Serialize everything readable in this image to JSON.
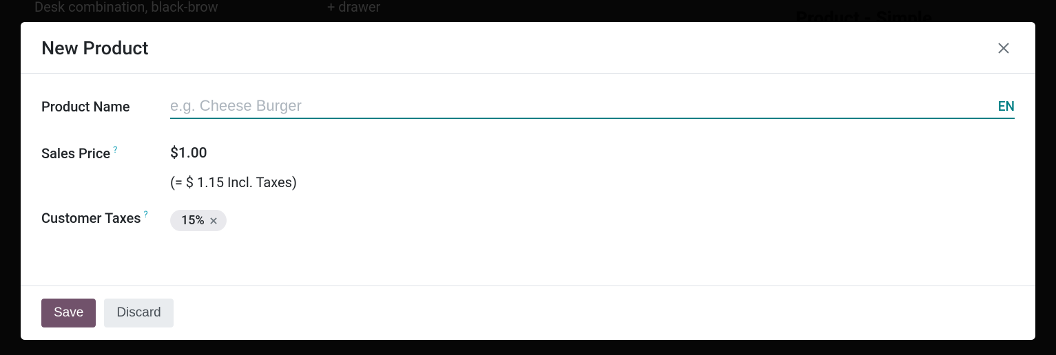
{
  "background": {
    "text_left": "Desk combination, black-brow",
    "text_mid": "+ drawer",
    "text_right": "Product - Simple"
  },
  "modal": {
    "title": "New Product",
    "fields": {
      "product_name": {
        "label": "Product Name",
        "placeholder": "e.g. Cheese Burger",
        "value": "",
        "lang": "EN"
      },
      "sales_price": {
        "label": "Sales Price",
        "value": "$1.00",
        "incl_taxes": "(= $ 1.15 Incl. Taxes)"
      },
      "customer_taxes": {
        "label": "Customer Taxes",
        "tags": [
          "15%"
        ]
      }
    },
    "buttons": {
      "save": "Save",
      "discard": "Discard"
    }
  }
}
